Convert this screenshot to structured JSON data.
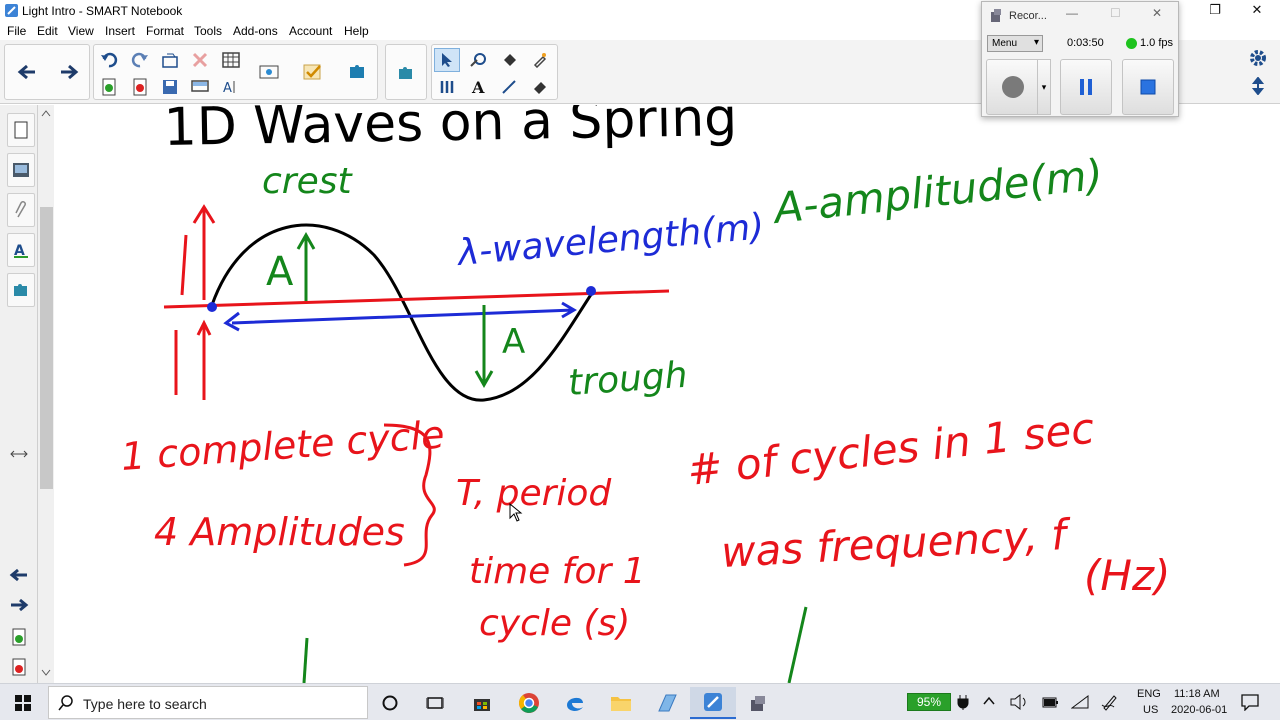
{
  "window": {
    "title": "Light Intro - SMART Notebook",
    "minimize": "—",
    "restore": "❐",
    "close": "✕"
  },
  "menu": [
    "File",
    "Edit",
    "View",
    "Insert",
    "Format",
    "Tools",
    "Add-ons",
    "Account",
    "Help"
  ],
  "recorder": {
    "title": "Recor...",
    "menu_label": "Menu",
    "elapsed": "0:03:50",
    "fps": "1.0 fps"
  },
  "taskbar": {
    "search_placeholder": "Type here to search",
    "battery": "95%",
    "language": "ENG",
    "region": "US",
    "time": "11:18 AM",
    "date": "2020-06-01"
  },
  "handwriting": {
    "title_partial": "1D Waves on a Spring",
    "crest": "crest",
    "trough": "trough",
    "amplitude_symbol": "A",
    "wavelength": "λ-wavelength(m)",
    "amplitude": "A-amplitude(m)",
    "complete_cycle": "1 complete cycle",
    "four_amplitudes": "4 Amplitudes",
    "period": "T, period",
    "time_for_1": "time for 1",
    "cycle_s": "cycle (s)",
    "cycles_in_sec": "# of cycles in 1 sec",
    "was_frequency": "was frequency, f",
    "hz": "(Hz)"
  },
  "colors": {
    "red_ink": "#e8141b",
    "green_ink": "#14861b",
    "blue_ink": "#1d2bd6",
    "black_ink": "#000000",
    "select_blue": "#cfe4f7"
  }
}
